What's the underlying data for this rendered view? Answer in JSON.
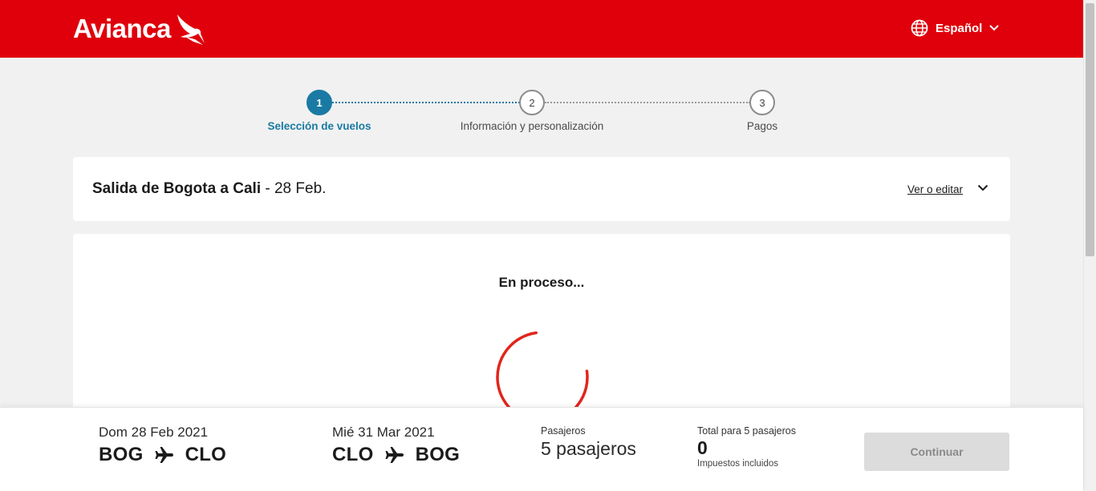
{
  "header": {
    "logo_text": "Avianca",
    "language_label": "Español",
    "brand_color": "#e0000b"
  },
  "stepper": {
    "steps": [
      {
        "number": "1",
        "label": "Selección de vuelos",
        "active": true
      },
      {
        "number": "2",
        "label": "Información y personalización",
        "active": false
      },
      {
        "number": "3",
        "label": "Pagos",
        "active": false
      }
    ],
    "accent_color": "#1a7aa3"
  },
  "flight": {
    "title_bold": "Salida de Bogota a Cali",
    "title_rest": " - 28 Feb.",
    "edit_label": "Ver o editar"
  },
  "loading": {
    "text": "En proceso..."
  },
  "bottom": {
    "outbound": {
      "date": "Dom 28 Feb 2021",
      "origin": "BOG",
      "destination": "CLO"
    },
    "return": {
      "date": "Mié 31 Mar 2021",
      "origin": "CLO",
      "destination": "BOG"
    },
    "passengers_label": "Pasajeros",
    "passengers_value": "5 pasajeros",
    "total_label": "Total para 5 pasajeros",
    "total_value": "0",
    "taxes_note": "Impuestos incluidos",
    "continue_label": "Continuar"
  }
}
